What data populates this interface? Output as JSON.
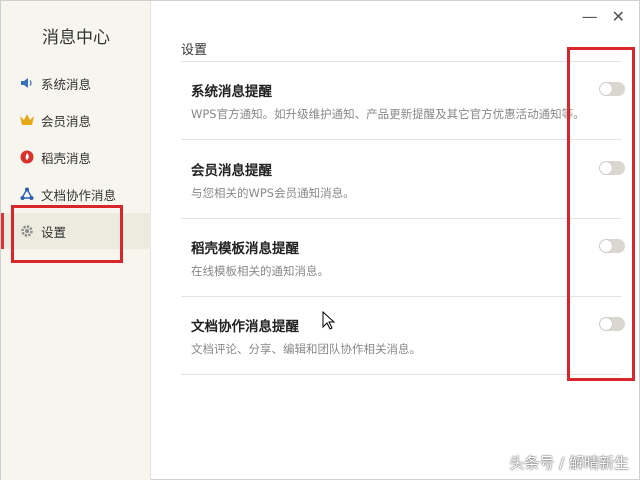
{
  "sidebar": {
    "title": "消息中心",
    "items": [
      {
        "label": "系统消息",
        "icon": "speaker-icon"
      },
      {
        "label": "会员消息",
        "icon": "crown-icon"
      },
      {
        "label": "稻壳消息",
        "icon": "flame-icon"
      },
      {
        "label": "文档协作消息",
        "icon": "share-nodes-icon"
      },
      {
        "label": "设置",
        "icon": "gear-icon"
      }
    ],
    "active_item": "设置"
  },
  "window_controls": {
    "minimize": "—",
    "close": "✕"
  },
  "main": {
    "section_title": "设置",
    "settings": [
      {
        "name": "系统消息提醒",
        "desc": "WPS官方通知。如升级维护通知、产品更新提醒及其它官方优惠活动通知等。",
        "enabled": false
      },
      {
        "name": "会员消息提醒",
        "desc": "与您相关的WPS会员通知消息。",
        "enabled": false
      },
      {
        "name": "稻壳模板消息提醒",
        "desc": "在线模板相关的通知消息。",
        "enabled": false
      },
      {
        "name": "文档协作消息提醒",
        "desc": "文档评论、分享、编辑和团队协作相关消息。",
        "enabled": false
      }
    ]
  },
  "watermark": "头条号 / 解晴新生",
  "colors": {
    "highlight_box": "#d9262c",
    "sidebar_bg": "#f6f5ee",
    "toggle_off": "#d9d7d0"
  }
}
